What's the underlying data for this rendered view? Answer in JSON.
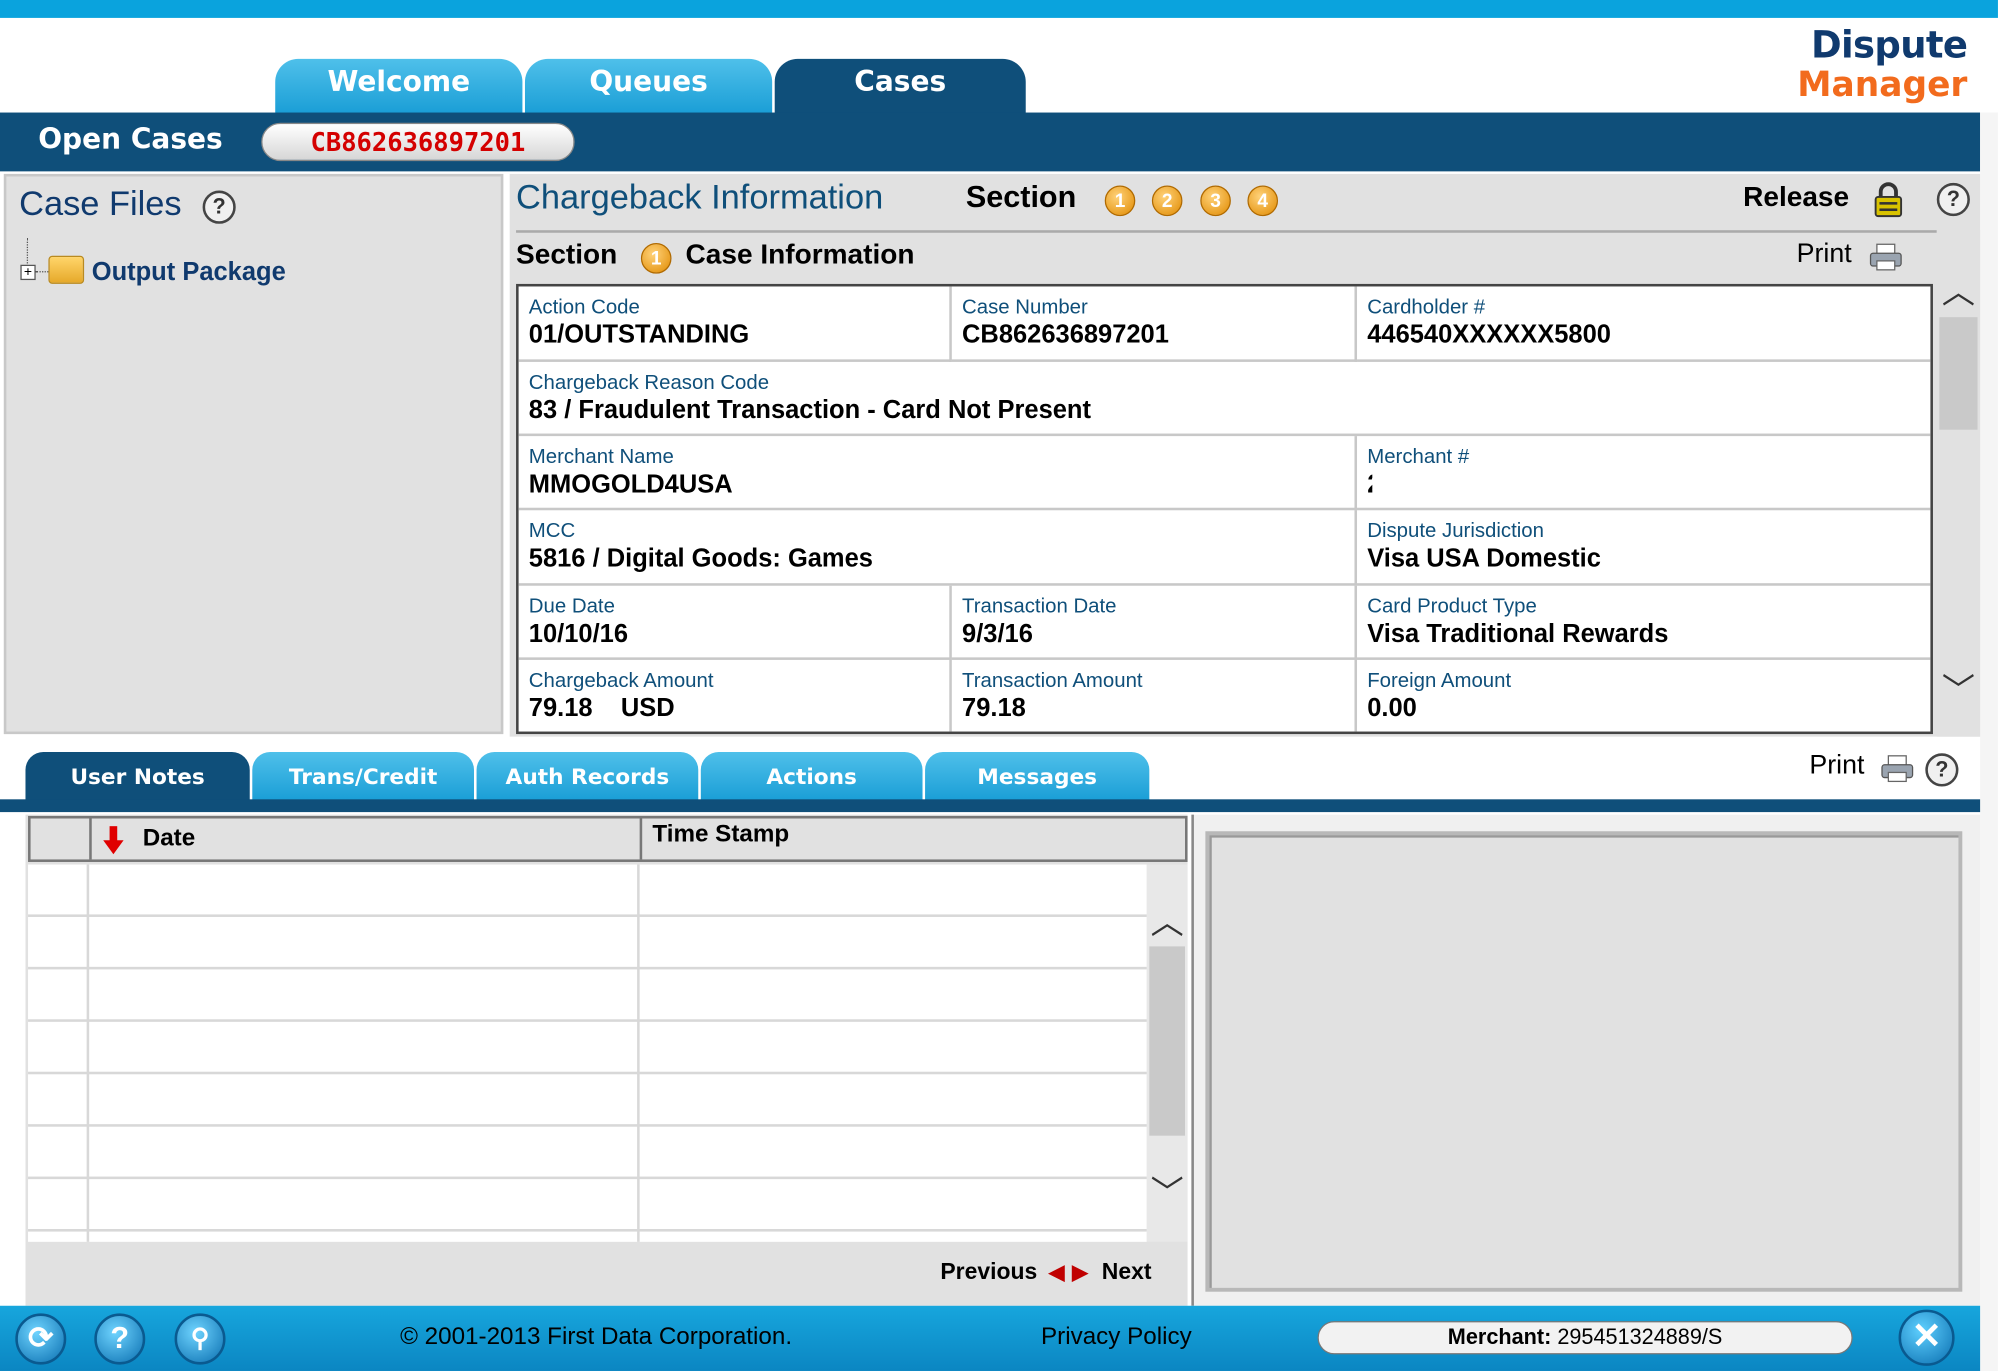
{
  "header": {
    "tabs": [
      "Welcome",
      "Queues",
      "Cases"
    ],
    "active_tab": "Cases",
    "logo_line1": "Dispute",
    "logo_line2": "Manager",
    "open_cases_label": "Open Cases",
    "open_case_id": "CB862636897201"
  },
  "left_panel": {
    "title": "Case Files",
    "tree_item": "Output Package"
  },
  "main": {
    "title": "Chargeback Information",
    "section_label": "Section",
    "section_numbers": [
      "1",
      "2",
      "3",
      "4"
    ],
    "release_label": "Release",
    "sub_section_label": "Section",
    "sub_section_number": "1",
    "sub_section_title": "Case Information",
    "print_label": "Print",
    "fields": {
      "action_code": {
        "label": "Action Code",
        "value": "01/OUTSTANDING"
      },
      "case_number": {
        "label": "Case Number",
        "value": "CB862636897201"
      },
      "cardholder": {
        "label": "Cardholder #",
        "value": "446540XXXXXX5800"
      },
      "reason_code": {
        "label": "Chargeback Reason Code",
        "value": "83 /  Fraudulent Transaction - Card Not Present"
      },
      "merchant_name": {
        "label": "Merchant Name",
        "value": "MMOGOLD4USA"
      },
      "merchant_no": {
        "label": "Merchant #",
        "value": "2"
      },
      "mcc": {
        "label": "MCC",
        "value": "5816 /  Digital Goods: Games"
      },
      "jurisdiction": {
        "label": "Dispute Jurisdiction",
        "value": "Visa  USA Domestic"
      },
      "due_date": {
        "label": "Due Date",
        "value": "10/10/16"
      },
      "transaction_date": {
        "label": "Transaction Date",
        "value": "9/3/16"
      },
      "card_product": {
        "label": "Card Product Type",
        "value": "Visa Traditional Rewards"
      },
      "chargeback_amount": {
        "label": "Chargeback Amount",
        "value": "79.18    USD"
      },
      "transaction_amount": {
        "label": "Transaction Amount",
        "value": "79.18"
      },
      "foreign_amount": {
        "label": "Foreign Amount",
        "value": "0.00"
      }
    }
  },
  "bottom": {
    "tabs": [
      "User Notes",
      "Trans/Credit",
      "Auth Records",
      "Actions",
      "Messages"
    ],
    "active_tab": "User Notes",
    "print_label": "Print",
    "columns": [
      "Date",
      "Time Stamp"
    ],
    "previous_label": "Previous",
    "next_label": "Next"
  },
  "footer": {
    "copyright": "© 2001-2013  First Data Corporation.",
    "privacy": "Privacy Policy",
    "merchant_label": "Merchant:",
    "merchant_value": " 295451324889/S"
  },
  "colors": {
    "accent_dark": "#0f4f7a",
    "accent_light": "#0aa3dd",
    "logo_orange": "#f26b1d",
    "case_id_red": "#d40000"
  }
}
